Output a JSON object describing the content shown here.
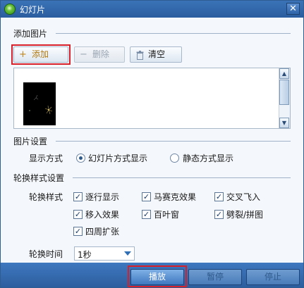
{
  "window": {
    "title": "幻灯片",
    "close_glyph": "✕"
  },
  "add_section": {
    "title": "添加图片",
    "add_button": "添加",
    "delete_button": "删除",
    "clear_button": "清空",
    "add_icon": "plus-icon",
    "delete_icon": "minus-icon",
    "clear_icon": "trash-icon"
  },
  "image_settings": {
    "title": "图片设置",
    "display_label": "显示方式",
    "options": [
      {
        "label": "幻灯片方式显示",
        "selected": true
      },
      {
        "label": "静态方式显示",
        "selected": false
      }
    ]
  },
  "transition_settings": {
    "title": "轮换样式设置",
    "style_label": "轮换样式",
    "styles": [
      {
        "label": "逐行显示",
        "checked": true
      },
      {
        "label": "马赛克效果",
        "checked": true
      },
      {
        "label": "交叉飞入",
        "checked": true
      },
      {
        "label": "移入效果",
        "checked": true
      },
      {
        "label": "百叶窗",
        "checked": true
      },
      {
        "label": "劈裂/拼图",
        "checked": true
      },
      {
        "label": "四周扩张",
        "checked": true
      }
    ],
    "time_label": "轮换时间",
    "time_value": "1秒"
  },
  "footer": {
    "play": "播放",
    "pause": "暂停",
    "stop": "停止"
  },
  "colors": {
    "title_bar": "#2f63a8",
    "highlight": "#d8202a",
    "footer": "#3569ae"
  }
}
